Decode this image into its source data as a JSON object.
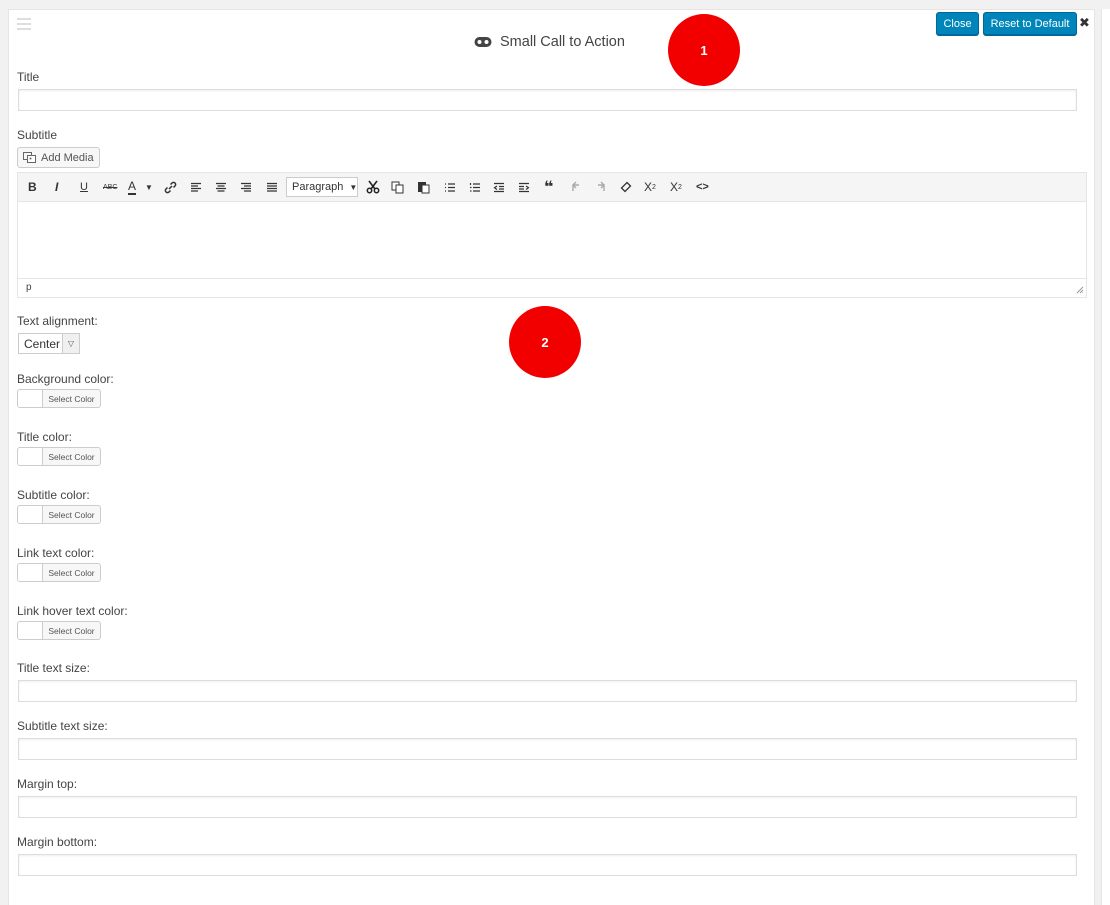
{
  "header": {
    "title": "Small Call to Action",
    "title_icon": "gamepad-icon",
    "close_label": "Close",
    "reset_label": "Reset to Default",
    "dismiss_glyph": "✖"
  },
  "badges": [
    "1",
    "2"
  ],
  "fields": {
    "title_label": "Title",
    "subtitle_label": "Subtitle",
    "text_alignment_label": "Text alignment:",
    "text_alignment_value": "Center",
    "background_color_label": "Background color:",
    "title_color_label": "Title color:",
    "subtitle_color_label": "Subtitle color:",
    "link_text_color_label": "Link text color:",
    "link_hover_text_color_label": "Link hover text color:",
    "title_text_size_label": "Title text size:",
    "subtitle_text_size_label": "Subtitle text size:",
    "margin_top_label": "Margin top:",
    "margin_bottom_label": "Margin bottom:",
    "select_color_label": "Select Color"
  },
  "editor": {
    "add_media_label": "Add Media",
    "format_select_value": "Paragraph",
    "status_path": "p",
    "toolbar_glyphs": {
      "bold": "B",
      "italic": "I",
      "underline": "U",
      "strikethrough": "ABC",
      "text_color": "A",
      "blockquote": "❝",
      "code": "<>"
    }
  },
  "colors": {
    "primary_button": "#0085ba",
    "badge": "#f20000",
    "border": "#dddddd"
  }
}
